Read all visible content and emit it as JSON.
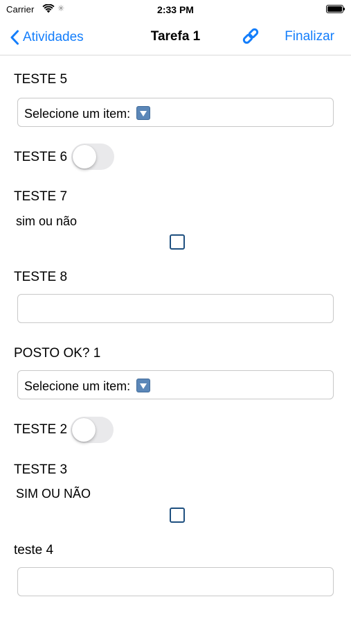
{
  "status_bar": {
    "carrier": "Carrier",
    "time": "2:33 PM",
    "wifi_icon": "wifi-icon",
    "activity_icon": "activity-spinner-icon",
    "battery_icon": "battery-full-icon"
  },
  "nav": {
    "back_label": "Atividades",
    "title": "Tarefa 1",
    "link_icon": "link-icon",
    "finish_label": "Finalizar",
    "accent_color": "#147efb"
  },
  "form": {
    "teste5": {
      "label": "TESTE 5",
      "select_value": "Selecione um item:"
    },
    "teste6": {
      "label": "TESTE 6",
      "toggle_on": false
    },
    "teste7": {
      "label": "TESTE 7",
      "sub_label": "sim ou não",
      "checked": false
    },
    "teste8": {
      "label": "TESTE 8",
      "value": ""
    },
    "posto": {
      "label": "POSTO OK? 1",
      "select_value": "Selecione um item:"
    },
    "teste2": {
      "label": "TESTE 2",
      "toggle_on": false
    },
    "teste3": {
      "label": "TESTE 3",
      "sub_label": "SIM OU NÃO",
      "checked": false
    },
    "teste4": {
      "label": "teste 4",
      "value": ""
    }
  }
}
